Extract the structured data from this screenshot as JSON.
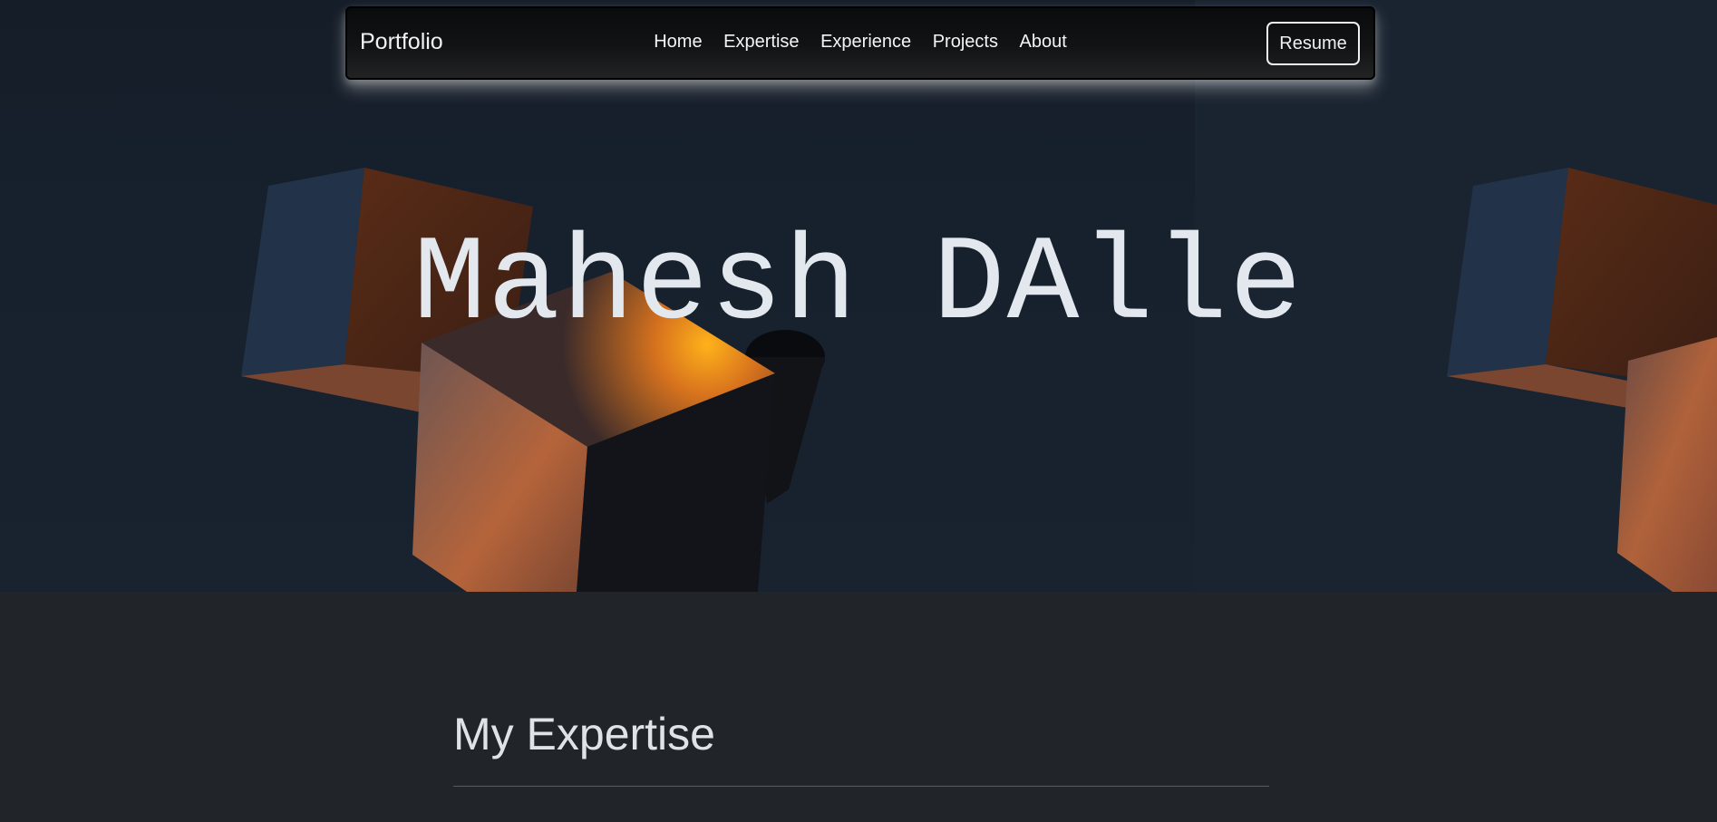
{
  "navbar": {
    "brand": "Portfolio",
    "links": [
      "Home",
      "Expertise",
      "Experience",
      "Projects",
      "About"
    ],
    "resume_label": "Resume"
  },
  "hero": {
    "title": "Mahesh DAlle"
  },
  "expertise": {
    "title": "My Expertise"
  }
}
